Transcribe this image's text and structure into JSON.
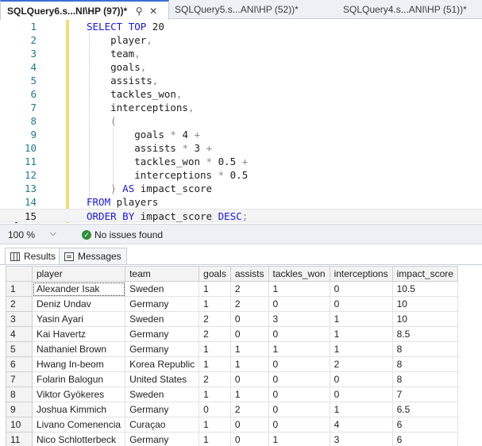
{
  "tabs": [
    {
      "label": "SQLQuery6.s...NI\\HP (97))*",
      "active": true,
      "pin": "⚲",
      "close": "✕"
    },
    {
      "label": "SQLQuery5.s...ANI\\HP (52))*",
      "active": false
    },
    {
      "label": "SQLQuery4.s...ANI\\HP (51))*",
      "active": false
    }
  ],
  "editor": {
    "current_line": 15,
    "lines": [
      {
        "n": "1",
        "code": "SELECT TOP 20"
      },
      {
        "n": "2",
        "code": "    player,"
      },
      {
        "n": "3",
        "code": "    team,"
      },
      {
        "n": "4",
        "code": "    goals,"
      },
      {
        "n": "5",
        "code": "    assists,"
      },
      {
        "n": "6",
        "code": "    tackles_won,"
      },
      {
        "n": "7",
        "code": "    interceptions,"
      },
      {
        "n": "8",
        "code": "    ("
      },
      {
        "n": "9",
        "code": "        goals * 4 +"
      },
      {
        "n": "10",
        "code": "        assists * 3 +"
      },
      {
        "n": "11",
        "code": "        tackles_won * 0.5 +"
      },
      {
        "n": "12",
        "code": "        interceptions * 0.5"
      },
      {
        "n": "13",
        "code": "    ) AS impact_score"
      },
      {
        "n": "14",
        "code": "FROM players"
      },
      {
        "n": "15",
        "code": "ORDER BY impact_score DESC;"
      }
    ]
  },
  "status": {
    "zoom": "100 %",
    "message": "No issues found"
  },
  "result_tabs": [
    {
      "label": "Results",
      "icon": "grid-icon",
      "active": true
    },
    {
      "label": "Messages",
      "icon": "messages-icon",
      "active": false
    }
  ],
  "results": {
    "columns": [
      "player",
      "team",
      "goals",
      "assists",
      "tackles_won",
      "interceptions",
      "impact_score"
    ],
    "rows": [
      [
        "1",
        "Alexander Isak",
        "Sweden",
        "1",
        "2",
        "1",
        "0",
        "10.5"
      ],
      [
        "2",
        "Deniz Undav",
        "Germany",
        "1",
        "2",
        "0",
        "0",
        "10"
      ],
      [
        "3",
        "Yasin Ayari",
        "Sweden",
        "2",
        "0",
        "3",
        "1",
        "10"
      ],
      [
        "4",
        "Kai Havertz",
        "Germany",
        "2",
        "0",
        "0",
        "1",
        "8.5"
      ],
      [
        "5",
        "Nathaniel Brown",
        "Germany",
        "1",
        "1",
        "1",
        "1",
        "8"
      ],
      [
        "6",
        "Hwang In-beom",
        "Korea Republic",
        "1",
        "1",
        "0",
        "2",
        "8"
      ],
      [
        "7",
        "Folarin Balogun",
        "United States",
        "2",
        "0",
        "0",
        "0",
        "8"
      ],
      [
        "8",
        "Viktor Gyökeres",
        "Sweden",
        "1",
        "1",
        "0",
        "0",
        "7"
      ],
      [
        "9",
        "Joshua Kimmich",
        "Germany",
        "0",
        "2",
        "0",
        "1",
        "6.5"
      ],
      [
        "10",
        "Livano Comenencia",
        "Curaçao",
        "1",
        "0",
        "0",
        "4",
        "6"
      ],
      [
        "11",
        "Nico Schlotterbeck",
        "Germany",
        "1",
        "0",
        "1",
        "3",
        "6"
      ]
    ]
  }
}
